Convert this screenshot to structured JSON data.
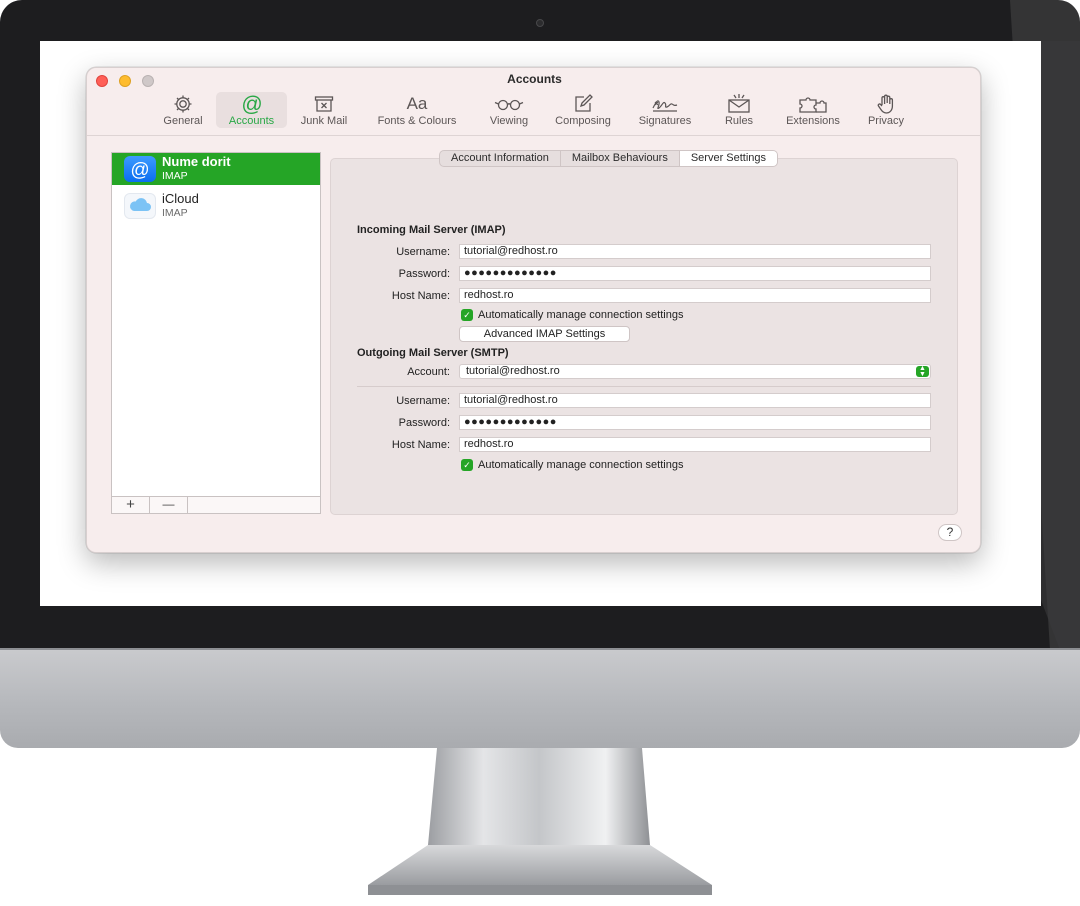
{
  "window": {
    "title": "Accounts"
  },
  "toolbar": {
    "items": [
      {
        "label": "General",
        "icon": "gear-icon"
      },
      {
        "label": "Accounts",
        "icon": "at-sign-icon",
        "active": true
      },
      {
        "label": "Junk Mail",
        "icon": "junk-tray-icon"
      },
      {
        "label": "Fonts & Colours",
        "icon": "aa-text-icon",
        "glyph": "Aa"
      },
      {
        "label": "Viewing",
        "icon": "glasses-icon"
      },
      {
        "label": "Composing",
        "icon": "pencil-square-icon"
      },
      {
        "label": "Signatures",
        "icon": "signature-icon"
      },
      {
        "label": "Rules",
        "icon": "envelope-rules-icon"
      },
      {
        "label": "Extensions",
        "icon": "puzzle-icon"
      },
      {
        "label": "Privacy",
        "icon": "hand-icon"
      }
    ]
  },
  "sidebar": {
    "accounts": [
      {
        "name": "Nume dorit",
        "type": "IMAP",
        "icon": "at-sign-icon",
        "selected": true
      },
      {
        "name": "iCloud",
        "type": "IMAP",
        "icon": "icloud-icon"
      }
    ],
    "add_label": "+",
    "remove_label": "—"
  },
  "tabs": [
    {
      "label": "Account Information"
    },
    {
      "label": "Mailbox Behaviours"
    },
    {
      "label": "Server Settings",
      "active": true
    }
  ],
  "incoming": {
    "title": "Incoming Mail Server (IMAP)",
    "username_label": "Username:",
    "username": "tutorial@redhost.ro",
    "password_label": "Password:",
    "password": "●●●●●●●●●●●●●",
    "host_label": "Host Name:",
    "host": "redhost.ro",
    "auto_manage_label": "Automatically manage connection settings",
    "advanced_button": "Advanced IMAP Settings"
  },
  "outgoing": {
    "title": "Outgoing Mail Server (SMTP)",
    "account_label": "Account:",
    "account": "tutorial@redhost.ro",
    "username_label": "Username:",
    "username": "tutorial@redhost.ro",
    "password_label": "Password:",
    "password": "●●●●●●●●●●●●●",
    "host_label": "Host Name:",
    "host": "redhost.ro",
    "auto_manage_label": "Automatically manage connection settings"
  },
  "help_label": "?",
  "colors": {
    "accent_green": "#25a526",
    "window_bg": "#f7eded",
    "panel_bg": "#ebe3e3",
    "bezel": "#1d1d1f",
    "close": "#ff5f57",
    "minimize": "#febc2e"
  }
}
